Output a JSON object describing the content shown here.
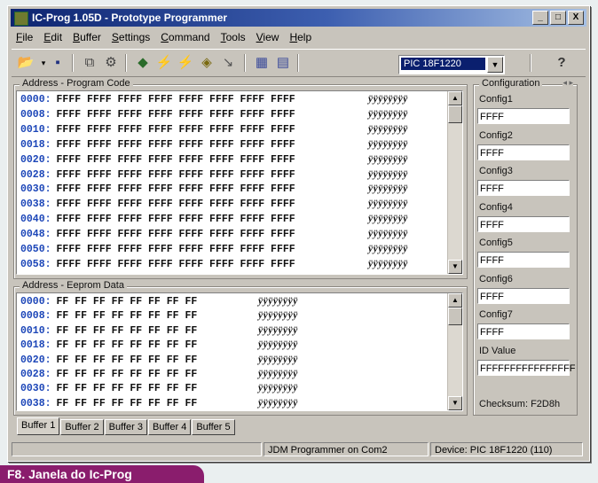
{
  "window": {
    "title": "IC-Prog 1.05D - Prototype Programmer",
    "controls": [
      "_",
      "□",
      "X"
    ]
  },
  "menu": [
    "File",
    "Edit",
    "Buffer",
    "Settings",
    "Command",
    "Tools",
    "View",
    "Help"
  ],
  "toolbar": {
    "device": "PIC 18F1220",
    "icons": [
      "open-icon",
      "save-icon",
      "chip-icon",
      "settings-icon",
      "read-icon",
      "program-icon",
      "erase-icon",
      "verify-icon",
      "blank-check-icon",
      "view-asm-icon",
      "view-hex-icon",
      "help-icon"
    ]
  },
  "program": {
    "title": "Address - Program Code",
    "rows": [
      {
        "addr": "0000:",
        "data": "FFFF FFFF FFFF FFFF FFFF FFFF FFFF FFFF",
        "ascii": "ÿÿÿÿÿÿÿÿ"
      },
      {
        "addr": "0008:",
        "data": "FFFF FFFF FFFF FFFF FFFF FFFF FFFF FFFF",
        "ascii": "ÿÿÿÿÿÿÿÿ"
      },
      {
        "addr": "0010:",
        "data": "FFFF FFFF FFFF FFFF FFFF FFFF FFFF FFFF",
        "ascii": "ÿÿÿÿÿÿÿÿ"
      },
      {
        "addr": "0018:",
        "data": "FFFF FFFF FFFF FFFF FFFF FFFF FFFF FFFF",
        "ascii": "ÿÿÿÿÿÿÿÿ"
      },
      {
        "addr": "0020:",
        "data": "FFFF FFFF FFFF FFFF FFFF FFFF FFFF FFFF",
        "ascii": "ÿÿÿÿÿÿÿÿ"
      },
      {
        "addr": "0028:",
        "data": "FFFF FFFF FFFF FFFF FFFF FFFF FFFF FFFF",
        "ascii": "ÿÿÿÿÿÿÿÿ"
      },
      {
        "addr": "0030:",
        "data": "FFFF FFFF FFFF FFFF FFFF FFFF FFFF FFFF",
        "ascii": "ÿÿÿÿÿÿÿÿ"
      },
      {
        "addr": "0038:",
        "data": "FFFF FFFF FFFF FFFF FFFF FFFF FFFF FFFF",
        "ascii": "ÿÿÿÿÿÿÿÿ"
      },
      {
        "addr": "0040:",
        "data": "FFFF FFFF FFFF FFFF FFFF FFFF FFFF FFFF",
        "ascii": "ÿÿÿÿÿÿÿÿ"
      },
      {
        "addr": "0048:",
        "data": "FFFF FFFF FFFF FFFF FFFF FFFF FFFF FFFF",
        "ascii": "ÿÿÿÿÿÿÿÿ"
      },
      {
        "addr": "0050:",
        "data": "FFFF FFFF FFFF FFFF FFFF FFFF FFFF FFFF",
        "ascii": "ÿÿÿÿÿÿÿÿ"
      },
      {
        "addr": "0058:",
        "data": "FFFF FFFF FFFF FFFF FFFF FFFF FFFF FFFF",
        "ascii": "ÿÿÿÿÿÿÿÿ"
      }
    ]
  },
  "eeprom": {
    "title": "Address - Eeprom Data",
    "rows": [
      {
        "addr": "0000:",
        "data": "FF FF FF FF FF FF FF FF",
        "ascii": "ÿÿÿÿÿÿÿÿ"
      },
      {
        "addr": "0008:",
        "data": "FF FF FF FF FF FF FF FF",
        "ascii": "ÿÿÿÿÿÿÿÿ"
      },
      {
        "addr": "0010:",
        "data": "FF FF FF FF FF FF FF FF",
        "ascii": "ÿÿÿÿÿÿÿÿ"
      },
      {
        "addr": "0018:",
        "data": "FF FF FF FF FF FF FF FF",
        "ascii": "ÿÿÿÿÿÿÿÿ"
      },
      {
        "addr": "0020:",
        "data": "FF FF FF FF FF FF FF FF",
        "ascii": "ÿÿÿÿÿÿÿÿ"
      },
      {
        "addr": "0028:",
        "data": "FF FF FF FF FF FF FF FF",
        "ascii": "ÿÿÿÿÿÿÿÿ"
      },
      {
        "addr": "0030:",
        "data": "FF FF FF FF FF FF FF FF",
        "ascii": "ÿÿÿÿÿÿÿÿ"
      },
      {
        "addr": "0038:",
        "data": "FF FF FF FF FF FF FF FF",
        "ascii": "ÿÿÿÿÿÿÿÿ"
      }
    ]
  },
  "config": {
    "title": "Configuration",
    "items": [
      {
        "label": "Config1",
        "value": "FFFF"
      },
      {
        "label": "Config2",
        "value": "FFFF"
      },
      {
        "label": "Config3",
        "value": "FFFF"
      },
      {
        "label": "Config4",
        "value": "FFFF"
      },
      {
        "label": "Config5",
        "value": "FFFF"
      },
      {
        "label": "Config6",
        "value": "FFFF"
      },
      {
        "label": "Config7",
        "value": "FFFF"
      },
      {
        "label": "ID Value",
        "value": "FFFFFFFFFFFFFFFF"
      }
    ],
    "checksum": "Checksum: F2D8h"
  },
  "tabs": [
    "Buffer 1",
    "Buffer 2",
    "Buffer 3",
    "Buffer 4",
    "Buffer 5"
  ],
  "status": {
    "programmer": "JDM Programmer on Com2",
    "device": "Device: PIC 18F1220  (110)"
  },
  "caption": "F8. Janela do Ic-Prog"
}
